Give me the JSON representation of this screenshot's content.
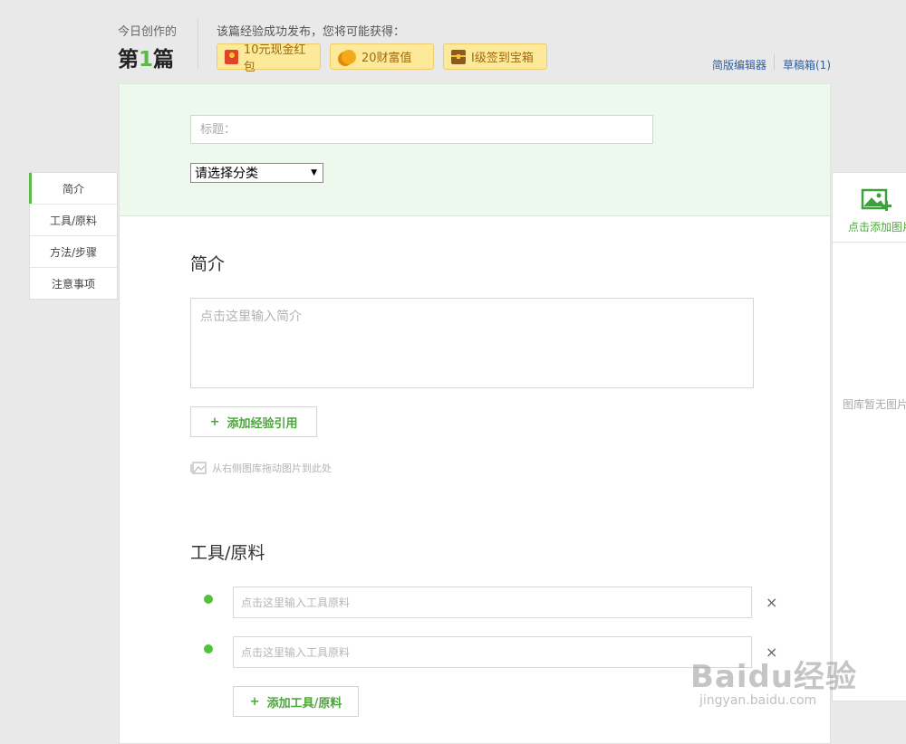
{
  "header": {
    "today_label": "今日创作的",
    "today_count_prefix": "第",
    "today_count_number": "1",
    "today_count_suffix": "篇",
    "reward_title": "该篇经验成功发布，您将可能获得：",
    "rewards": [
      {
        "label": "10元现金红包",
        "icon": "red-packet-icon"
      },
      {
        "label": "20财富值",
        "icon": "coin-icon"
      },
      {
        "label": "I级签到宝箱",
        "icon": "treasure-chest-icon"
      }
    ],
    "simple_editor_link": "简版编辑器",
    "drafts_link": "草稿箱(1)"
  },
  "title_area": {
    "title_placeholder": "标题：",
    "category_selected": "请选择分类"
  },
  "left_nav": {
    "items": [
      "简介",
      "工具/原料",
      "方法/步骤",
      "注意事项"
    ],
    "active_index": 0
  },
  "right_panel": {
    "add_image_label": "点击添加图片",
    "no_image_label": "图库暂无图片"
  },
  "intro": {
    "heading": "简介",
    "placeholder": "点击这里输入简介",
    "add_reference_button": "添加经验引用",
    "drag_hint": "从右侧图库拖动图片到此处"
  },
  "tools": {
    "heading": "工具/原料",
    "input_placeholder": "点击这里输入工具原料",
    "add_button": "添加工具/原料",
    "remove_symbol": "×"
  },
  "watermark": {
    "brand": "Baidu经验",
    "url": "jingyan.baidu.com"
  },
  "colors": {
    "accent_green": "#5fb84d",
    "title_area_bg": "#eef9ee",
    "reward_bg": "#fce99a",
    "link_blue": "#2b5f9e"
  }
}
